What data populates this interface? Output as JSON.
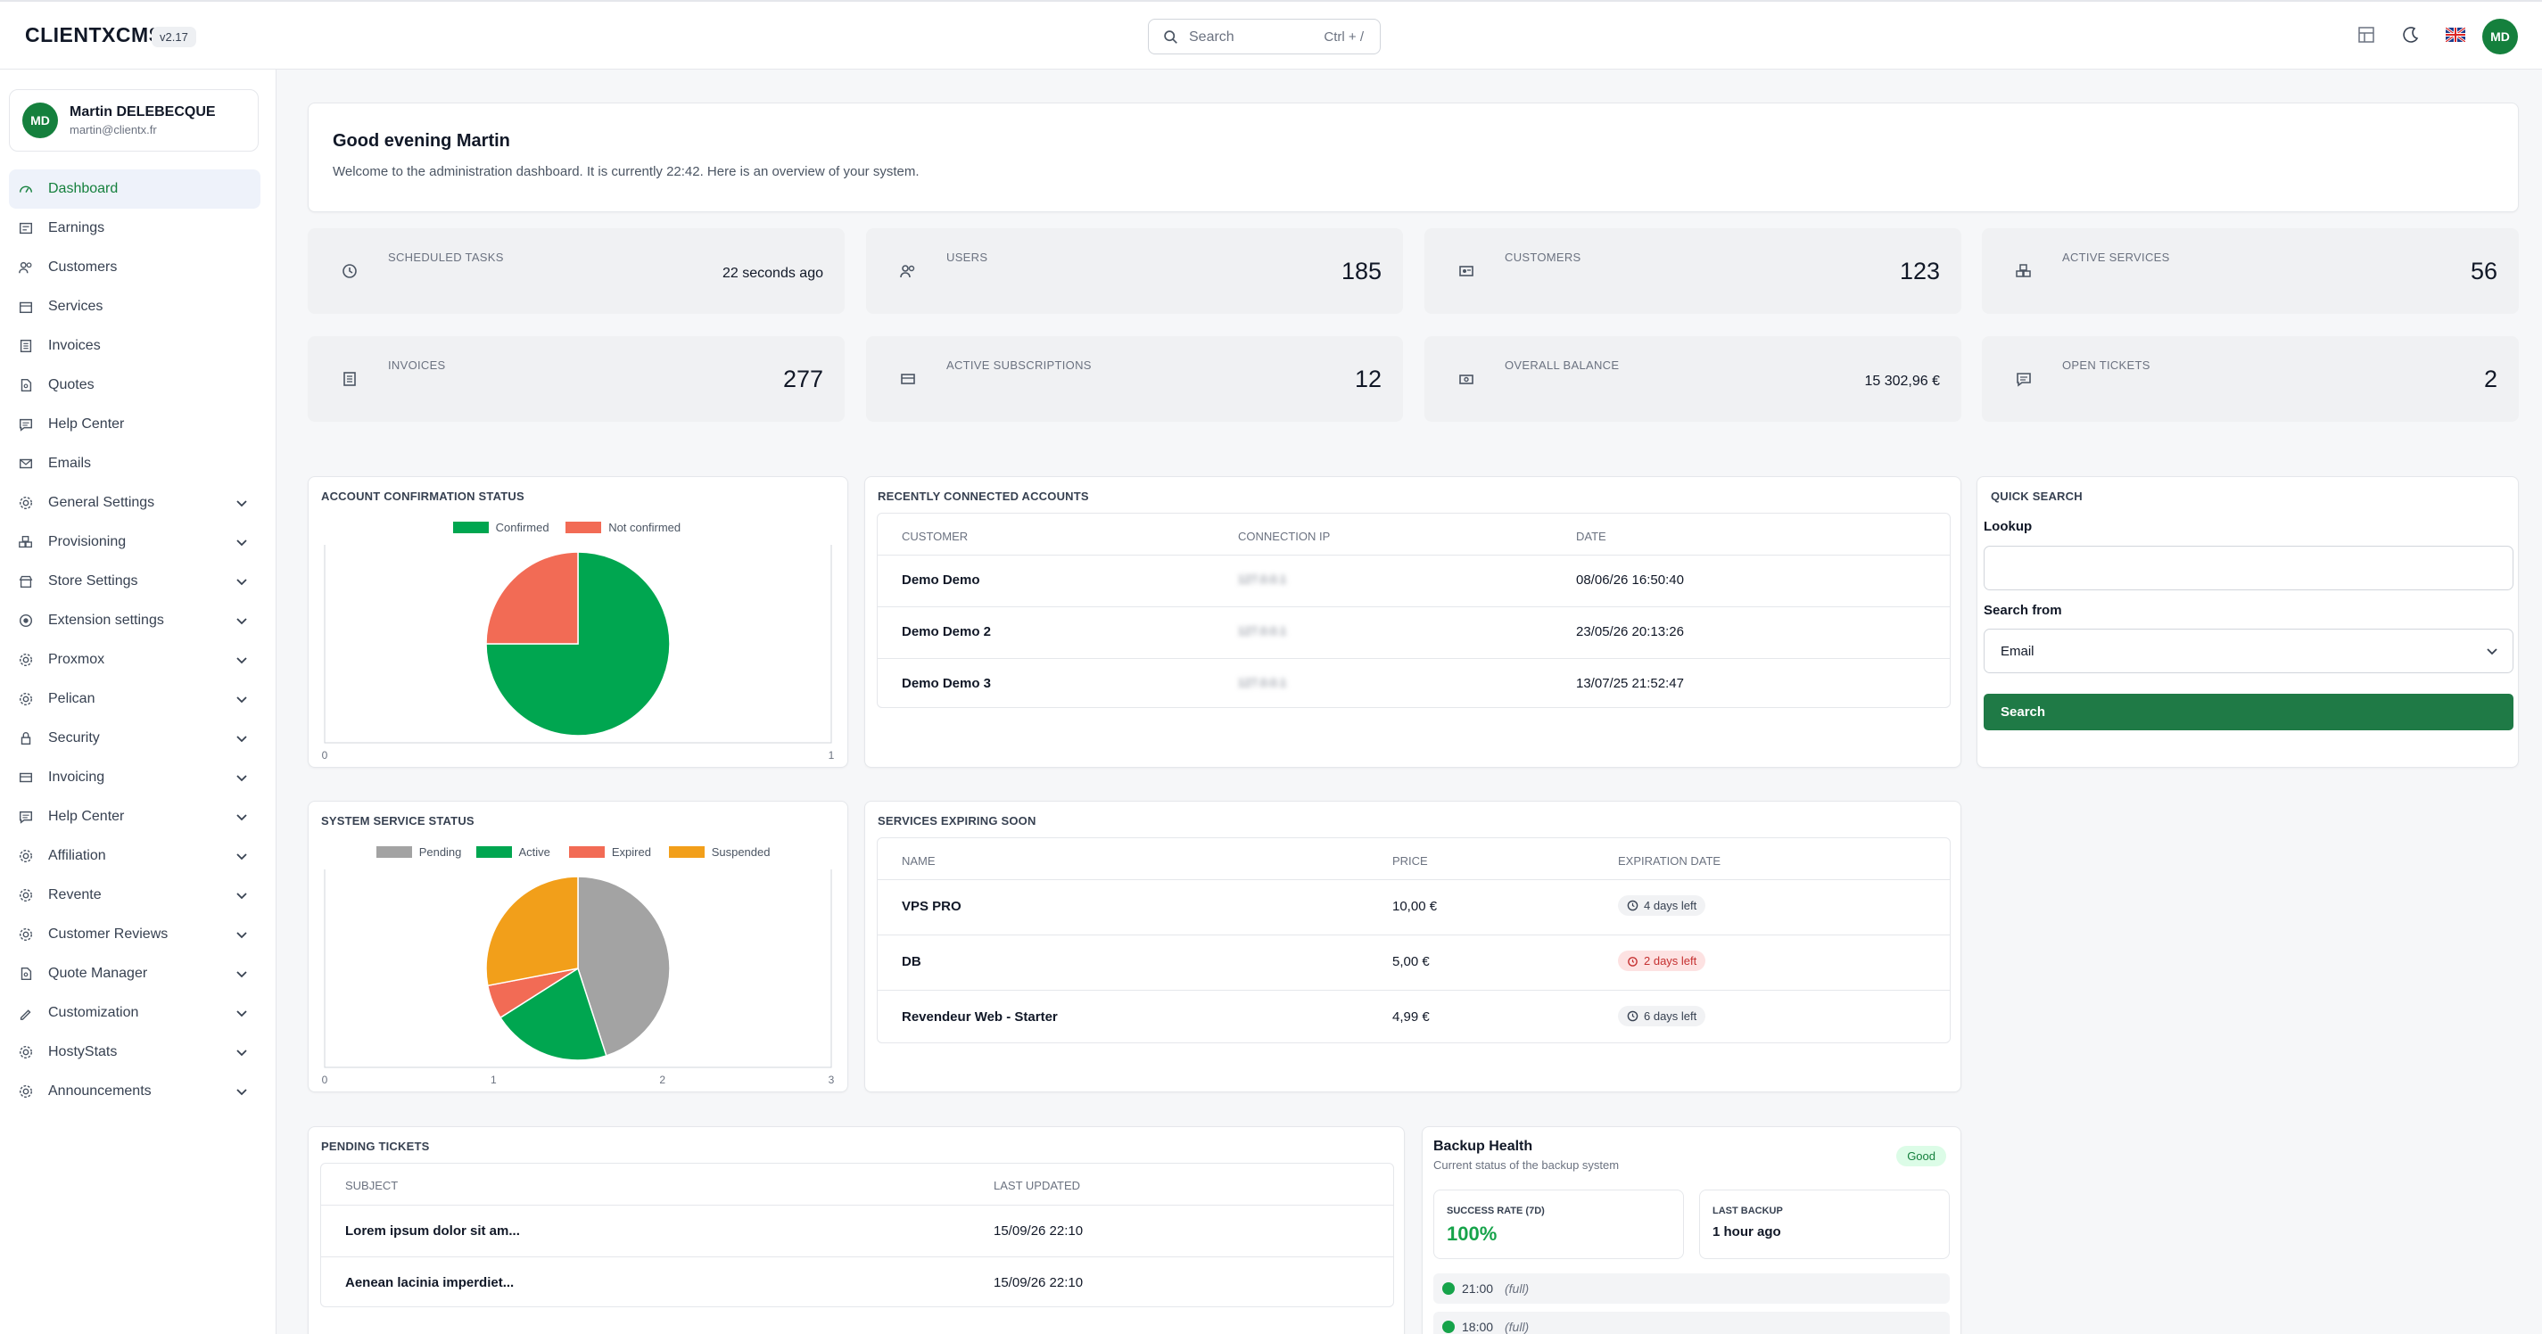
{
  "header": {
    "brand": "CLIENTXCMS",
    "version": "v2.17",
    "search_placeholder": "Search",
    "search_shortcut": "Ctrl + /",
    "user_initials": "MD"
  },
  "sidebar": {
    "user": {
      "initials": "MD",
      "name": "Martin DELEBECQUE",
      "email": "martin@clientx.fr"
    },
    "items": [
      {
        "label": "Dashboard",
        "icon": "gauge-icon",
        "active": true,
        "expandable": false
      },
      {
        "label": "Earnings",
        "icon": "earnings-icon",
        "expandable": false
      },
      {
        "label": "Customers",
        "icon": "users-icon",
        "expandable": false
      },
      {
        "label": "Services",
        "icon": "box-icon",
        "expandable": false
      },
      {
        "label": "Invoices",
        "icon": "invoice-icon",
        "expandable": false
      },
      {
        "label": "Quotes",
        "icon": "file-icon",
        "expandable": false
      },
      {
        "label": "Help Center",
        "icon": "chat-icon",
        "expandable": false
      },
      {
        "label": "Emails",
        "icon": "mail-icon",
        "expandable": false
      },
      {
        "label": "General Settings",
        "icon": "gear-icon",
        "expandable": true
      },
      {
        "label": "Provisioning",
        "icon": "cubes-icon",
        "expandable": true
      },
      {
        "label": "Store Settings",
        "icon": "store-icon",
        "expandable": true
      },
      {
        "label": "Extension settings",
        "icon": "extension-icon",
        "expandable": true
      },
      {
        "label": "Proxmox",
        "icon": "gear-icon",
        "expandable": true
      },
      {
        "label": "Pelican",
        "icon": "gear-icon",
        "expandable": true
      },
      {
        "label": "Security",
        "icon": "lock-icon",
        "expandable": true
      },
      {
        "label": "Invoicing",
        "icon": "card-icon",
        "expandable": true
      },
      {
        "label": "Help Center",
        "icon": "chat-icon",
        "expandable": true
      },
      {
        "label": "Affiliation",
        "icon": "gear-icon",
        "expandable": true
      },
      {
        "label": "Revente",
        "icon": "gear-icon",
        "expandable": true
      },
      {
        "label": "Customer Reviews",
        "icon": "gear-icon",
        "expandable": true
      },
      {
        "label": "Quote Manager",
        "icon": "file-icon",
        "expandable": true
      },
      {
        "label": "Customization",
        "icon": "brush-icon",
        "expandable": true
      },
      {
        "label": "HostyStats",
        "icon": "gear-icon",
        "expandable": true
      },
      {
        "label": "Announcements",
        "icon": "gear-icon",
        "expandable": true
      }
    ]
  },
  "welcome": {
    "title": "Good evening Martin",
    "subtitle": "Welcome to the administration dashboard. It is currently 22:42. Here is an overview of your system."
  },
  "stats": [
    {
      "label": "SCHEDULED TASKS",
      "value": "22 seconds ago",
      "icon": "clock-icon"
    },
    {
      "label": "USERS",
      "value": "185",
      "icon": "users-icon"
    },
    {
      "label": "CUSTOMERS",
      "value": "123",
      "icon": "id-card-icon"
    },
    {
      "label": "ACTIVE SERVICES",
      "value": "56",
      "icon": "cubes-icon"
    },
    {
      "label": "INVOICES",
      "value": "277",
      "icon": "invoice-icon"
    },
    {
      "label": "ACTIVE SUBSCRIPTIONS",
      "value": "12",
      "icon": "card-icon"
    },
    {
      "label": "OVERALL BALANCE",
      "value": "15 302,96 €",
      "icon": "cash-icon"
    },
    {
      "label": "OPEN TICKETS",
      "value": "2",
      "icon": "chat-icon"
    }
  ],
  "account_confirmation": {
    "title": "ACCOUNT CONFIRMATION STATUS",
    "x_ticks": [
      "0",
      "1"
    ]
  },
  "recent_accounts": {
    "title": "RECENTLY CONNECTED ACCOUNTS",
    "headers": [
      "CUSTOMER",
      "CONNECTION IP",
      "DATE"
    ],
    "rows": [
      {
        "customer": "Demo Demo",
        "ip": "127.0.0.1",
        "date": "08/06/26 16:50:40"
      },
      {
        "customer": "Demo Demo 2",
        "ip": "127.0.0.1",
        "date": "23/05/26 20:13:26"
      },
      {
        "customer": "Demo Demo 3",
        "ip": "127.0.0.1",
        "date": "13/07/25 21:52:47"
      }
    ]
  },
  "quick_search": {
    "title": "QUICK SEARCH",
    "lookup_label": "Lookup",
    "lookup_value": "",
    "search_from_label": "Search from",
    "search_from_value": "Email",
    "button": "Search"
  },
  "service_status": {
    "title": "SYSTEM SERVICE STATUS",
    "x_ticks": [
      "0",
      "1",
      "2",
      "3"
    ]
  },
  "expiring": {
    "title": "SERVICES EXPIRING SOON",
    "headers": [
      "NAME",
      "PRICE",
      "EXPIRATION DATE"
    ],
    "rows": [
      {
        "name": "VPS PRO",
        "price": "10,00 €",
        "expiry": "4 days left",
        "urgent": false
      },
      {
        "name": "DB",
        "price": "5,00 €",
        "expiry": "2 days left",
        "urgent": true
      },
      {
        "name": "Revendeur Web - Starter",
        "price": "4,99 €",
        "expiry": "6 days left",
        "urgent": false
      }
    ]
  },
  "pending_tickets": {
    "title": "PENDING TICKETS",
    "headers": [
      "SUBJECT",
      "LAST UPDATED"
    ],
    "rows": [
      {
        "subject": "Lorem ipsum dolor sit am...",
        "updated": "15/09/26 22:10"
      },
      {
        "subject": "Aenean lacinia imperdiet...",
        "updated": "15/09/26 22:10"
      }
    ]
  },
  "backup": {
    "title": "Backup Health",
    "subtitle": "Current status of the backup system",
    "status": "Good",
    "success_label": "SUCCESS RATE (7D)",
    "success_value": "100%",
    "last_label": "LAST BACKUP",
    "last_value": "1 hour ago",
    "entries": [
      {
        "time": "21:00",
        "mode": "(full)"
      },
      {
        "time": "18:00",
        "mode": "(full)"
      }
    ]
  },
  "colors": {
    "accent": "#15803d",
    "confirmed": "#00a650",
    "not_confirmed": "#f26b55",
    "pending": "#a3a3a3",
    "suspended": "#f29f1a"
  },
  "chart_data": [
    {
      "type": "pie",
      "categories": [
        "Confirmed",
        "Not confirmed"
      ],
      "values": [
        3,
        1
      ],
      "colors": [
        "#00a650",
        "#f26b55"
      ],
      "legend": "top",
      "xlim": [
        0,
        1
      ]
    },
    {
      "type": "pie",
      "categories": [
        "Pending",
        "Active",
        "Expired",
        "Suspended"
      ],
      "values": [
        45,
        21,
        6,
        28
      ],
      "colors": [
        "#a3a3a3",
        "#00a650",
        "#f26b55",
        "#f29f1a"
      ],
      "legend": "top",
      "xlim": [
        0,
        3
      ]
    }
  ]
}
